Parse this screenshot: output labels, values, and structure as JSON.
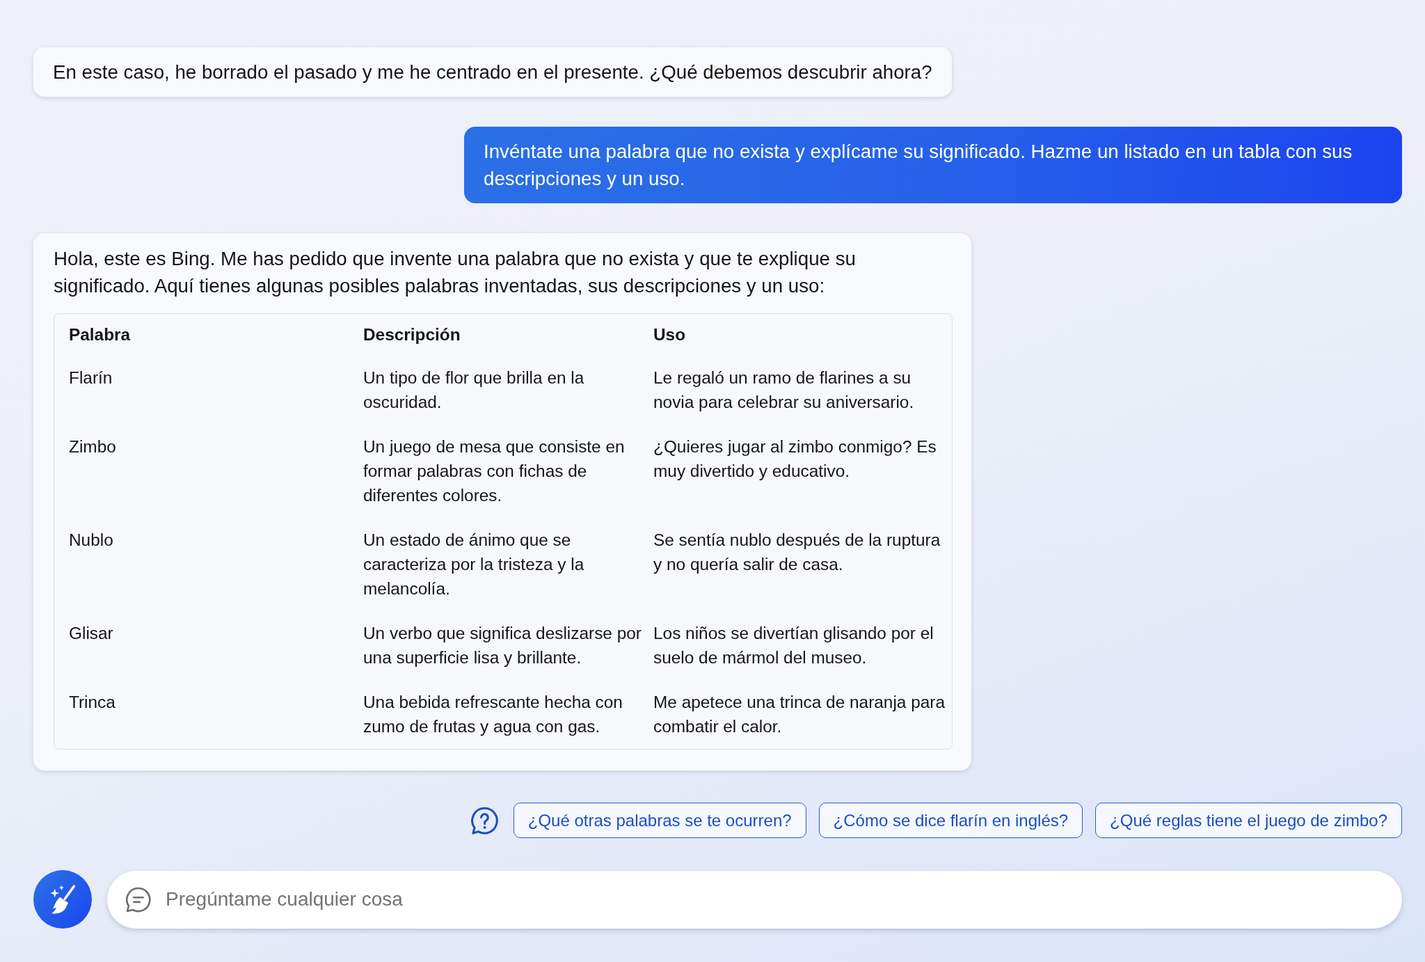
{
  "messages": [
    {
      "kind": "bot",
      "text": "En este caso, he borrado el pasado y me he centrado en el presente. ¿Qué debemos descubrir ahora?"
    },
    {
      "kind": "user",
      "text": "Invéntate una palabra que no exista y explícame su significado. Hazme un listado en un tabla con sus descripciones y un uso."
    },
    {
      "kind": "bot",
      "text": "Hola, este es Bing. Me has pedido que invente una palabra que no exista y que te explique su significado. Aquí tienes algunas posibles palabras inventadas, sus descripciones y un uso:",
      "table": {
        "columns": [
          "Palabra",
          "Descripción",
          "Uso"
        ],
        "rows": [
          [
            "Flarín",
            "Un tipo de flor que brilla en la oscuridad.",
            "Le regaló un ramo de flarines a su novia para celebrar su aniversario."
          ],
          [
            "Zimbo",
            "Un juego de mesa que consiste en formar palabras con fichas de diferentes colores.",
            "¿Quieres jugar al zimbo conmigo? Es muy divertido y educativo."
          ],
          [
            "Nublo",
            "Un estado de ánimo que se caracteriza por la tristeza y la melancolía.",
            "Se sentía nublo después de la ruptura y no quería salir de casa."
          ],
          [
            "Glisar",
            "Un verbo que significa deslizarse por una superficie lisa y brillante.",
            "Los niños se divertían glisando por el suelo de mármol del museo."
          ],
          [
            "Trinca",
            "Una bebida refrescante hecha con zumo de frutas y agua con gas.",
            "Me apetece una trinca de naranja para combatir el calor."
          ]
        ]
      }
    }
  ],
  "suggestions": [
    "¿Qué otras palabras se te ocurren?",
    "¿Cómo se dice flarín en inglés?",
    "¿Qué reglas tiene el juego de zimbo?"
  ],
  "input": {
    "placeholder": "Pregúntame cualquier cosa"
  }
}
